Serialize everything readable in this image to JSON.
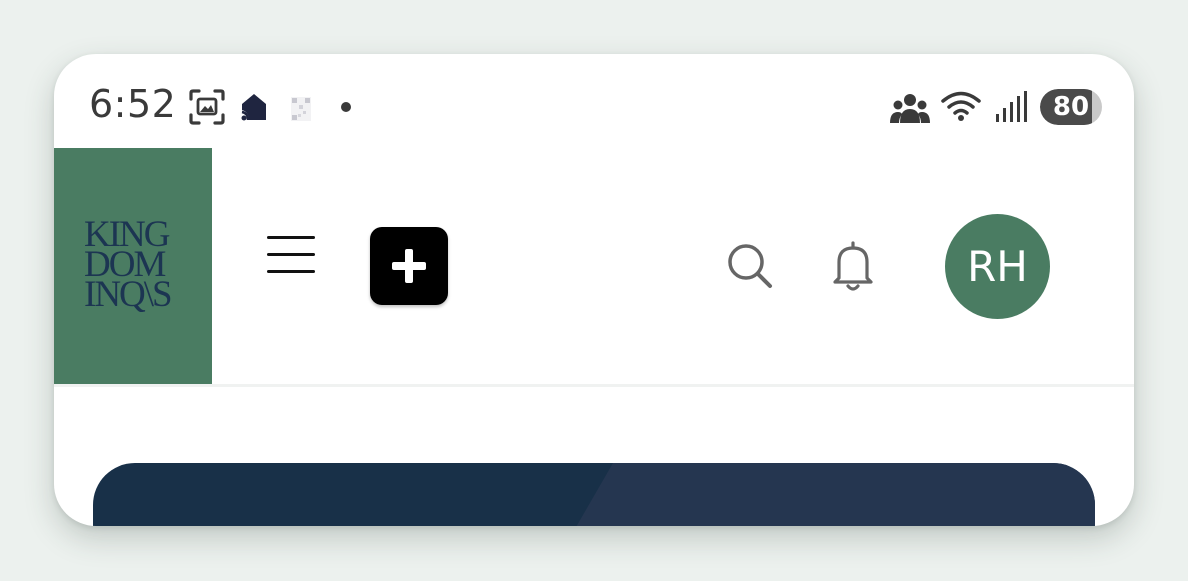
{
  "status_bar": {
    "time": "6:52",
    "battery_level": "80",
    "icons": [
      "screenshot-icon",
      "home-notification-icon",
      "qr-code-icon",
      "dot-icon",
      "people-icon",
      "wifi-icon",
      "signal-icon",
      "battery-icon"
    ]
  },
  "header": {
    "logo_lines": [
      "KING",
      "DOM",
      "INQ\\S"
    ],
    "avatar_initials": "RH",
    "brand_color": "#4a7c62"
  },
  "hero": {
    "color_left": "#183048",
    "color_right": "#253650"
  }
}
